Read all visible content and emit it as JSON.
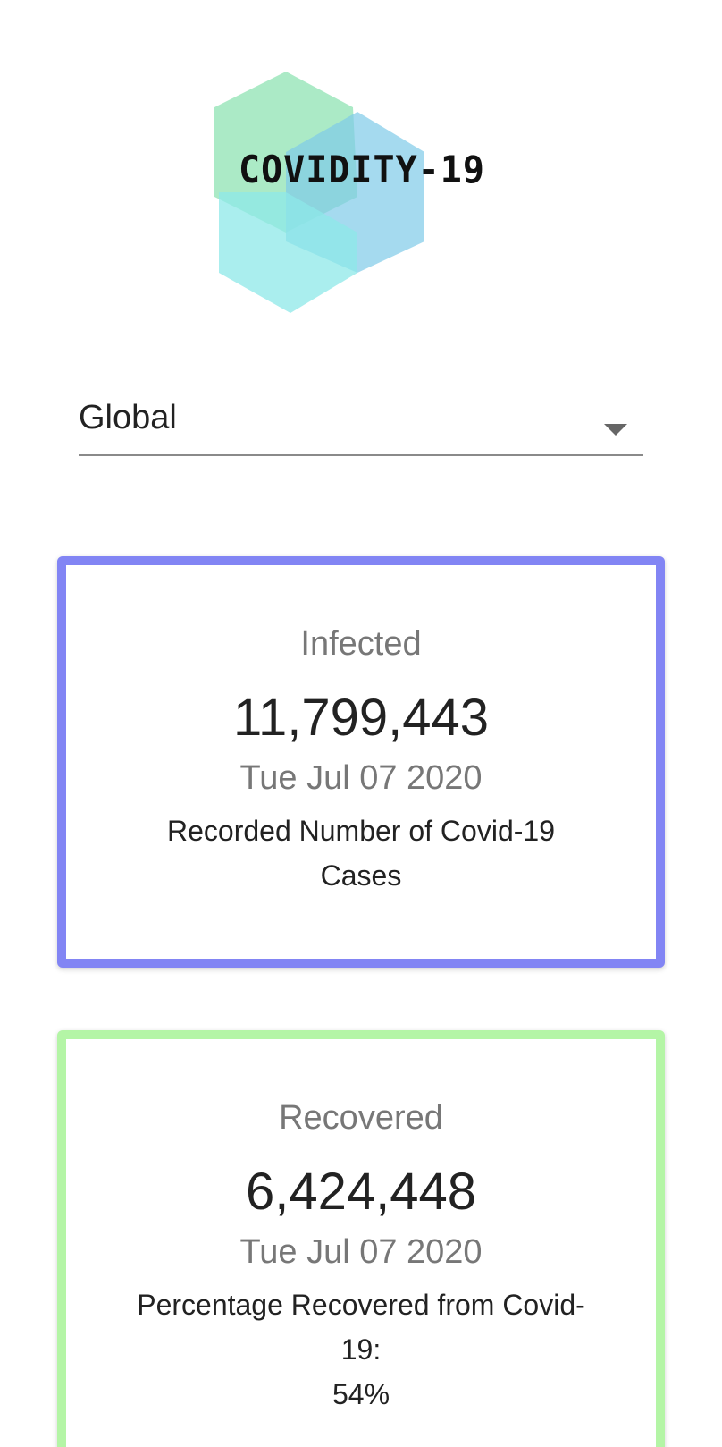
{
  "logo": {
    "text": "COVIDITY-19",
    "colors": [
      "#9fe9c0",
      "#8fd6ee",
      "#a0ecec"
    ]
  },
  "region_select": {
    "value": "Global"
  },
  "cards": {
    "infected": {
      "title": "Infected",
      "value": "11,799,443",
      "date": "Tue Jul 07 2020",
      "description": "Recorded Number of Covid-19 Cases",
      "border_color": "#8285f4"
    },
    "recovered": {
      "title": "Recovered",
      "value": "6,424,448",
      "date": "Tue Jul 07 2020",
      "description": "Percentage Recovered from Covid-19:",
      "percent": "54%",
      "border_color": "#b4f5a6"
    }
  }
}
